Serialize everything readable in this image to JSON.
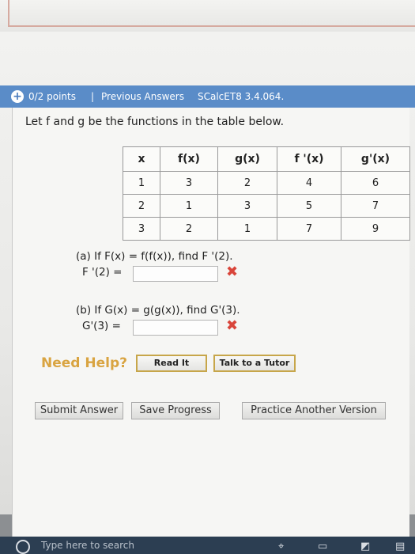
{
  "header": {
    "points": "0/2 points",
    "separator": "|",
    "previous_answers": "Previous Answers",
    "problem_code": "SCalcET8 3.4.064."
  },
  "problem": {
    "prompt": "Let f and g be the functions in the table below."
  },
  "table": {
    "columns": [
      "x",
      "f(x)",
      "g(x)",
      "f '(x)",
      "g'(x)"
    ],
    "rows": [
      [
        "1",
        "3",
        "2",
        "4",
        "6"
      ],
      [
        "2",
        "1",
        "3",
        "5",
        "7"
      ],
      [
        "3",
        "2",
        "1",
        "7",
        "9"
      ]
    ]
  },
  "part_a": {
    "question": "(a) If F(x) = f(f(x)), find F '(2).",
    "answer_label": "F '(2) =",
    "answer_value": "",
    "status": "✖"
  },
  "part_b": {
    "question": "(b) If G(x) = g(g(x)), find G'(3).",
    "answer_label": "G'(3) =",
    "answer_value": "",
    "status": "✖"
  },
  "help": {
    "label": "Need Help?",
    "read_it": "Read It",
    "talk_to_tutor": "Talk to a Tutor"
  },
  "actions": {
    "submit": "Submit Answer",
    "save": "Save Progress",
    "practice": "Practice Another Version"
  },
  "taskbar": {
    "search_placeholder": "Type here to search"
  }
}
